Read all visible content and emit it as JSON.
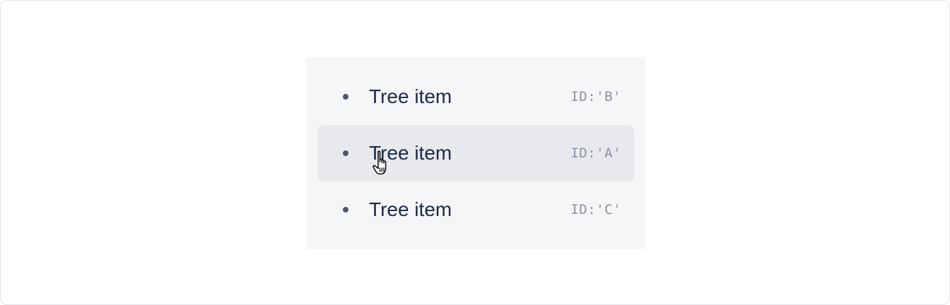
{
  "tree": {
    "items": [
      {
        "label": "Tree item",
        "id": "ID:'B'",
        "hovered": false
      },
      {
        "label": "Tree item",
        "id": "ID:'A'",
        "hovered": true
      },
      {
        "label": "Tree item",
        "id": "ID:'C'",
        "hovered": false
      }
    ]
  },
  "colors": {
    "panel_bg": "#f5f6f8",
    "hover_bg": "#e8e9ec",
    "label": "#1b2a48",
    "id_text": "#8a93a3",
    "bullet": "#4a5670"
  },
  "icons": {
    "cursor": "hand-pointer-icon"
  }
}
